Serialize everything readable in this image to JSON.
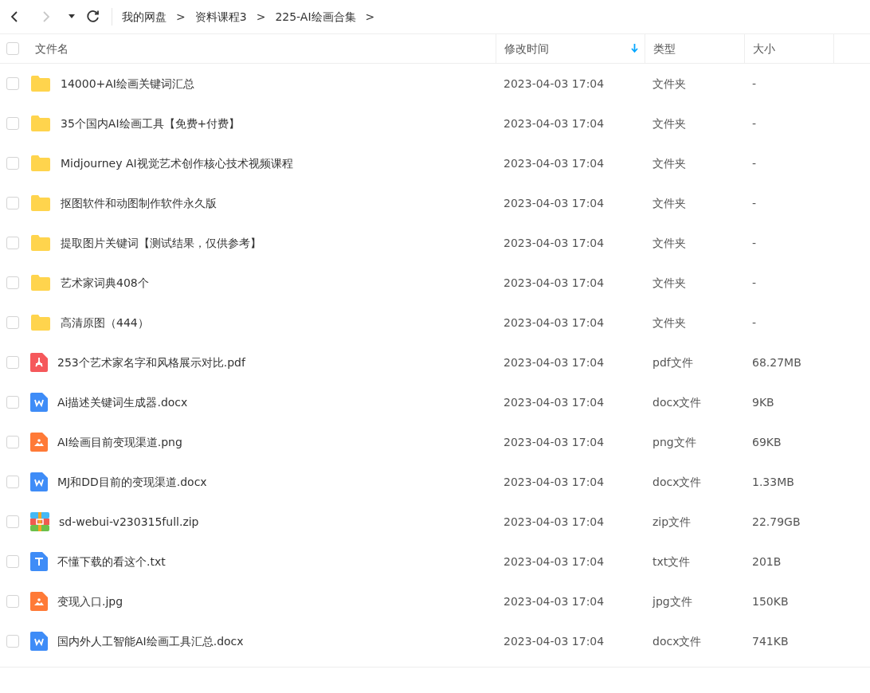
{
  "toolbar": {
    "back": {
      "disabled": false
    },
    "forward": {
      "disabled": true
    }
  },
  "breadcrumb": [
    {
      "label": "我的网盘",
      "separator": ">"
    },
    {
      "label": "资料课程3",
      "separator": ">"
    },
    {
      "label": "225-AI绘画合集",
      "separator": ">"
    }
  ],
  "table": {
    "select_all": {
      "checked": false
    },
    "columns": [
      {
        "label": "文件名",
        "sorted": false
      },
      {
        "label": "修改时间",
        "sorted": true
      },
      {
        "label": "类型",
        "sorted": false
      },
      {
        "label": "大小",
        "sorted": false
      }
    ],
    "rows": [
      {
        "kind": "folder",
        "checked": false,
        "name": "14000+AI绘画关键词汇总",
        "modified": "2023-04-03 17:04",
        "type": "文件夹",
        "size": "-"
      },
      {
        "kind": "folder",
        "checked": false,
        "name": "35个国内AI绘画工具【免费+付费】",
        "modified": "2023-04-03 17:04",
        "type": "文件夹",
        "size": "-"
      },
      {
        "kind": "folder",
        "checked": false,
        "name": "Midjourney AI视觉艺术创作核心技术视频课程",
        "modified": "2023-04-03 17:04",
        "type": "文件夹",
        "size": "-"
      },
      {
        "kind": "folder",
        "checked": false,
        "name": "抠图软件和动图制作软件永久版",
        "modified": "2023-04-03 17:04",
        "type": "文件夹",
        "size": "-"
      },
      {
        "kind": "folder",
        "checked": false,
        "name": "提取图片关键词【测试结果，仅供参考】",
        "modified": "2023-04-03 17:04",
        "type": "文件夹",
        "size": "-"
      },
      {
        "kind": "folder",
        "checked": false,
        "name": "艺术家词典408个",
        "modified": "2023-04-03 17:04",
        "type": "文件夹",
        "size": "-"
      },
      {
        "kind": "folder",
        "checked": false,
        "name": "高清原图（444）",
        "modified": "2023-04-03 17:04",
        "type": "文件夹",
        "size": "-"
      },
      {
        "kind": "pdf",
        "checked": false,
        "name": "253个艺术家名字和风格展示对比.pdf",
        "modified": "2023-04-03 17:04",
        "type": "pdf文件",
        "size": "68.27MB"
      },
      {
        "kind": "word",
        "checked": false,
        "name": "Ai描述关键词生成器.docx",
        "modified": "2023-04-03 17:04",
        "type": "docx文件",
        "size": "9KB"
      },
      {
        "kind": "image",
        "checked": false,
        "name": "AI绘画目前变现渠道.png",
        "modified": "2023-04-03 17:04",
        "type": "png文件",
        "size": "69KB"
      },
      {
        "kind": "word",
        "checked": false,
        "name": "MJ和DD目前的变现渠道.docx",
        "modified": "2023-04-03 17:04",
        "type": "docx文件",
        "size": "1.33MB"
      },
      {
        "kind": "zip",
        "checked": false,
        "name": "sd-webui-v230315full.zip",
        "modified": "2023-04-03 17:04",
        "type": "zip文件",
        "size": "22.79GB"
      },
      {
        "kind": "text",
        "checked": false,
        "name": "不懂下载的看这个.txt",
        "modified": "2023-04-03 17:04",
        "type": "txt文件",
        "size": "201B"
      },
      {
        "kind": "image",
        "checked": false,
        "name": "变现入口.jpg",
        "modified": "2023-04-03 17:04",
        "type": "jpg文件",
        "size": "150KB"
      },
      {
        "kind": "word",
        "checked": false,
        "name": "国内外人工智能AI绘画工具汇总.docx",
        "modified": "2023-04-03 17:04",
        "type": "docx文件",
        "size": "741KB"
      }
    ]
  }
}
